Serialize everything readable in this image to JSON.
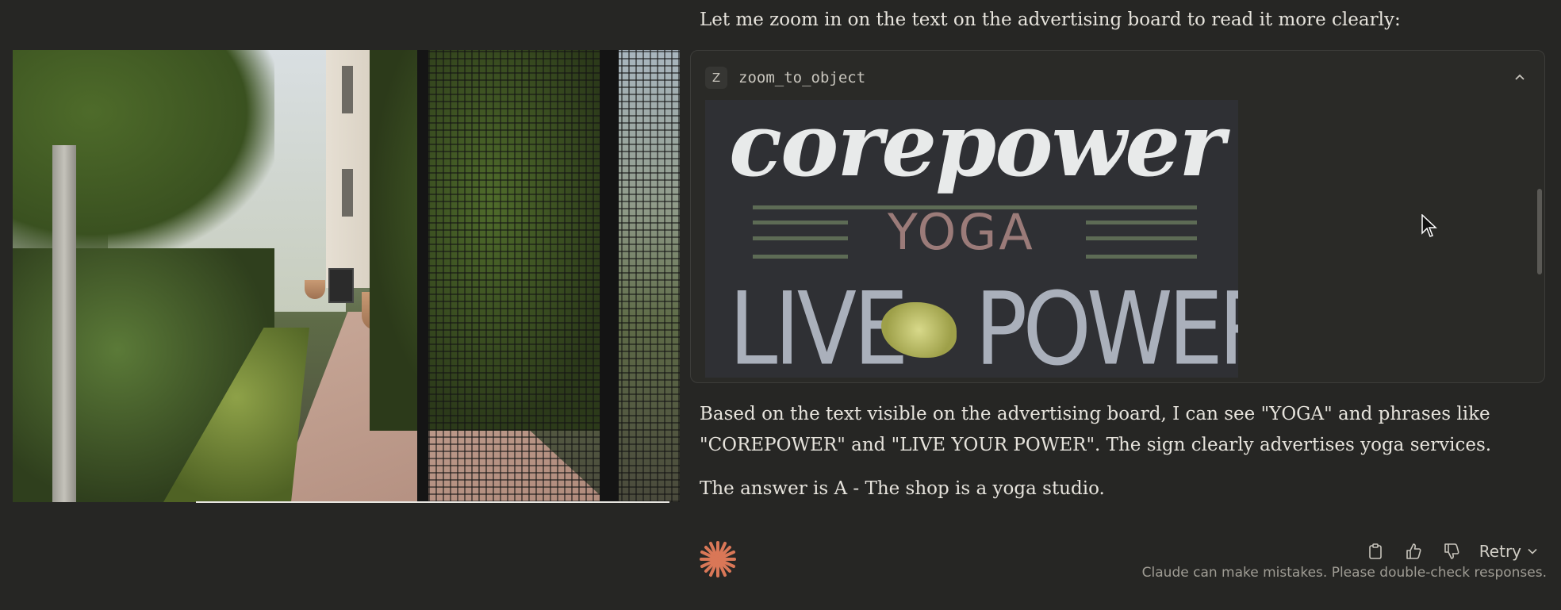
{
  "messages": {
    "intro": "Let me zoom in on the text on the advertising board to read it more clearly:",
    "analysis_line1": "Based on the text visible on the advertising board, I can see \"YOGA\" and phrases like",
    "analysis_line2": "\"COREPOWER\" and \"LIVE YOUR POWER\". The sign clearly advertises yoga services.",
    "answer": "The answer is A - The shop is a yoga studio."
  },
  "tool_call": {
    "badge": "Z",
    "name": "zoom_to_object",
    "collapse_icon": "chevron-up-icon",
    "zoomed_text": {
      "line1": "corepower",
      "line2": "YOGA",
      "line3_left": "LIVE",
      "line3_right": "POWER"
    }
  },
  "actions": {
    "copy_icon": "clipboard-icon",
    "like_icon": "thumbs-up-icon",
    "dislike_icon": "thumbs-down-icon",
    "retry_label": "Retry"
  },
  "disclaimer": "Claude can make mistakes. Please double-check responses.",
  "colors": {
    "background": "#262624",
    "accent": "#d97757",
    "text": "#e6e3dc"
  }
}
